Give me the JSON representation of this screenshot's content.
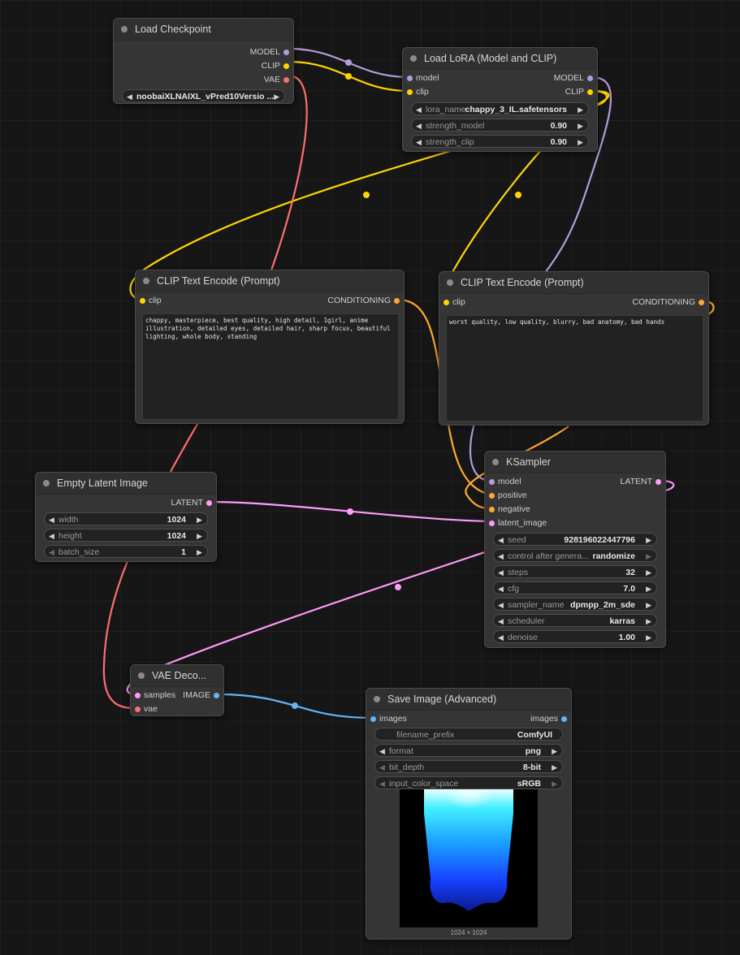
{
  "colors": {
    "model": "#b39ddb",
    "clip": "#ffd500",
    "vae": "#ff6e6e",
    "conditioning": "#ffa931",
    "latent": "#ff9cf9",
    "image": "#64b5f6"
  },
  "load_checkpoint": {
    "title": "Load Checkpoint",
    "outputs": [
      "MODEL",
      "CLIP",
      "VAE"
    ],
    "ckpt_name": "noobaiXLNAIXL_vPred10Versio ..."
  },
  "load_lora": {
    "title": "Load LoRA (Model and CLIP)",
    "inputs": [
      "model",
      "clip"
    ],
    "outputs": [
      "MODEL",
      "CLIP"
    ],
    "widgets": [
      {
        "name": "lora_name",
        "value": "chappy_3_IL.safetensors"
      },
      {
        "name": "strength_model",
        "value": "0.90"
      },
      {
        "name": "strength_clip",
        "value": "0.90"
      }
    ]
  },
  "clip_pos": {
    "title": "CLIP Text Encode (Prompt)",
    "input": "clip",
    "output": "CONDITIONING",
    "text": "chappy, masterpiece, best quality, high detail, 1girl, anime illustration, detailed eyes, detailed hair, sharp focus, beautiful lighting, whole body, standing"
  },
  "clip_neg": {
    "title": "CLIP Text Encode (Prompt)",
    "input": "clip",
    "output": "CONDITIONING",
    "text": "worst quality, low quality, blurry, bad anatomy, bad hands"
  },
  "empty_latent": {
    "title": "Empty Latent Image",
    "output": "LATENT",
    "widgets": [
      {
        "name": "width",
        "value": "1024"
      },
      {
        "name": "height",
        "value": "1024"
      },
      {
        "name": "batch_size",
        "value": "1"
      }
    ]
  },
  "ksampler": {
    "title": "KSampler",
    "inputs": [
      "model",
      "positive",
      "negative",
      "latent_image"
    ],
    "output": "LATENT",
    "widgets": [
      {
        "name": "seed",
        "value": "928196022447796"
      },
      {
        "name": "control after genera...",
        "value": "randomize"
      },
      {
        "name": "steps",
        "value": "32"
      },
      {
        "name": "cfg",
        "value": "7.0"
      },
      {
        "name": "sampler_name",
        "value": "dpmpp_2m_sde"
      },
      {
        "name": "scheduler",
        "value": "karras"
      },
      {
        "name": "denoise",
        "value": "1.00"
      }
    ]
  },
  "vae_decode": {
    "title": "VAE Deco...",
    "inputs": [
      "samples",
      "vae"
    ],
    "output": "IMAGE"
  },
  "save_image": {
    "title": "Save Image (Advanced)",
    "input": "images",
    "output": "images",
    "widgets": [
      {
        "name": "filename_prefix",
        "value": "ComfyUI"
      },
      {
        "name": "format",
        "value": "png"
      },
      {
        "name": "bit_depth",
        "value": "8-bit"
      },
      {
        "name": "input_color_space",
        "value": "sRGB"
      }
    ],
    "preview_caption": "1024 × 1024"
  },
  "icons": {
    "left": "◀",
    "right": "▶"
  }
}
